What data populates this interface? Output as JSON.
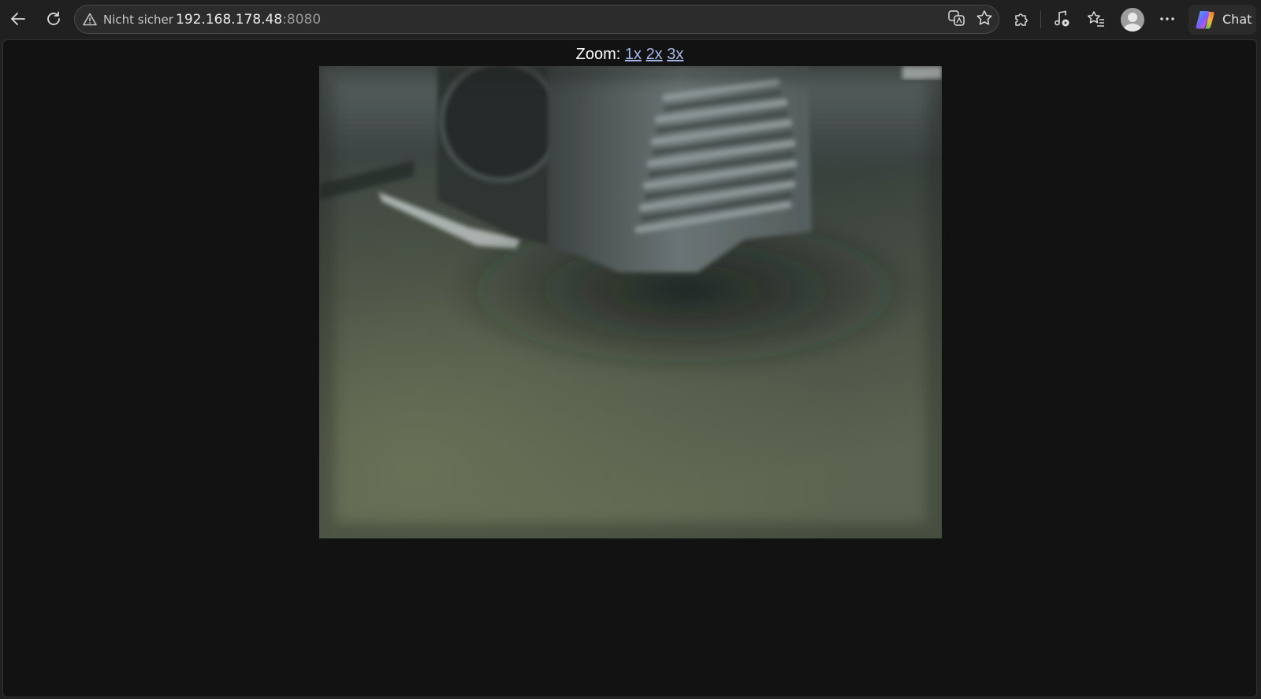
{
  "browser": {
    "security_label": "Nicht sicher",
    "url_host": "192.168.178.48",
    "url_port": ":8080",
    "chat_label": "Chat"
  },
  "page": {
    "zoom_label": "Zoom:",
    "zoom_options": [
      "1x",
      "2x",
      "3x"
    ]
  },
  "icons": {
    "back": "back-arrow-icon",
    "reload": "reload-icon",
    "warning": "warning-triangle-icon",
    "translate": "translate-icon",
    "favorite": "star-icon",
    "extensions": "puzzle-icon",
    "media": "music-note-icon",
    "favorites_bar": "favorites-list-icon",
    "profile": "profile-avatar-icon",
    "menu": "more-dots-icon",
    "copilot": "copilot-logo-icon"
  },
  "colors": {
    "toolbar_bg": "#202020",
    "page_bg": "#121212",
    "link": "#a9b7e6"
  }
}
